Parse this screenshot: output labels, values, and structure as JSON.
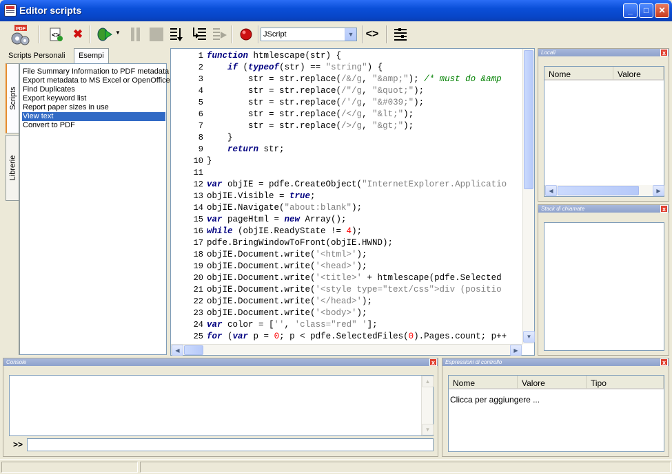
{
  "window": {
    "title": "Editor scripts",
    "minimize": "_",
    "maximize": "□",
    "close": "✕"
  },
  "toolbar": {
    "items": [
      "pdf-settings-icon",
      "new-script-icon",
      "delete-icon",
      "run-icon",
      "pause-icon",
      "stop-icon",
      "step-into-icon",
      "step-over-icon",
      "step-out-icon",
      "breakpoint-icon"
    ],
    "language": "JScript",
    "pdf_badge": "PDF"
  },
  "left": {
    "tabs": [
      "Scripts Personali",
      "Esempi"
    ],
    "vtabs": [
      "Scripts",
      "Librerie"
    ],
    "scripts": [
      "File Summary Information to PDF metadata",
      "Export metadata to MS Excel or OpenOffice",
      "Find Duplicates",
      "Export keyword list",
      "Report paper sizes in use",
      "View text",
      "Convert to PDF"
    ],
    "selected_index": 5
  },
  "editor": {
    "lines": [
      "function htmlescape(str) {",
      "    if (typeof(str) == \"string\") {",
      "        str = str.replace(/&/g, \"&amp;\"); /* must do &amp",
      "        str = str.replace(/\"/g, \"&quot;\");",
      "        str = str.replace(/'/g, \"&#039;\");",
      "        str = str.replace(/</g, \"&lt;\");",
      "        str = str.replace(/>/g, \"&gt;\");",
      "    }",
      "    return str;",
      "}",
      "",
      "var objIE = pdfe.CreateObject(\"InternetExplorer.Applicatio",
      "objIE.Visible = true;",
      "objIE.Navigate(\"about:blank\");",
      "var pageHtml = new Array();",
      "while (objIE.ReadyState != 4);",
      "pdfe.BringWindowToFront(objIE.HWND);",
      "objIE.Document.write('<html>');",
      "objIE.Document.write('<head>');",
      "objIE.Document.write('<title>' + htmlescape(pdfe.Selected",
      "objIE.Document.write('<style type=\"text/css\">div (positio",
      "objIE.Document.write('</head>');",
      "objIE.Document.write('<body>');",
      "var color = ['', 'class=\"red\" '];",
      "for (var p = 0; p < pdfe.SelectedFiles(0).Pages.count; p++"
    ]
  },
  "locals": {
    "title": "Locali",
    "col_name": "Nome",
    "col_value": "Valore"
  },
  "callstack": {
    "title": "Stack di chiamate"
  },
  "console": {
    "title": "Console",
    "prompt": ">>",
    "input": ""
  },
  "watch": {
    "title": "Espressioni di controllo",
    "col_name": "Nome",
    "col_value": "Valore",
    "col_type": "Tipo",
    "add_hint": "Clicca per aggiungere ..."
  },
  "colors": {
    "keyword": "#000080",
    "string": "#808080",
    "comment": "#008000",
    "number": "#ff0000"
  }
}
